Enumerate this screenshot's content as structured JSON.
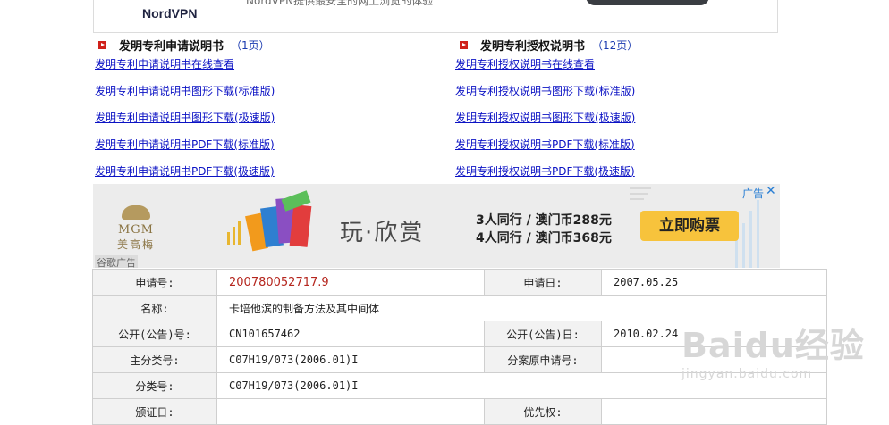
{
  "top_ad": {
    "brand": "NordVPN",
    "tagline": "NordVPN提供最安全的网上浏览的体验"
  },
  "application_section": {
    "title": "发明专利申请说明书",
    "count": "（1页）",
    "links": [
      "发明专利申请说明书在线查看",
      "发明专利申请说明书图形下载(标准版)",
      "发明专利申请说明书图形下载(极速版)",
      "发明专利申请说明书PDF下载(标准版)",
      "发明专利申请说明书PDF下载(极速版)"
    ]
  },
  "grant_section": {
    "title": "发明专利授权说明书",
    "count": "（12页）",
    "links": [
      "发明专利授权说明书在线查看",
      "发明专利授权说明书图形下载(标准版)",
      "发明专利授权说明书图形下载(极速版)",
      "发明专利授权说明书PDF下载(标准版)",
      "发明专利授权说明书PDF下载(极速版)"
    ]
  },
  "banner_ad": {
    "logo_text": "MGM",
    "logo_cn": "美高梅",
    "headline": "玩·欣赏",
    "offer1": "3人同行 / 澳门币288元",
    "offer2": "4人同行 / 澳门币368元",
    "cta": "立即购票",
    "ad_label": "广告",
    "ad_close": "✕",
    "ad_source": "谷歌广告"
  },
  "patent_info": {
    "rows": [
      {
        "k1": "申请号:",
        "v1": "200780052717.9",
        "k2": "申请日:",
        "v2": "2007.05.25"
      },
      {
        "k1": "名称:",
        "v1": "卡培他滨的制备方法及其中间体"
      },
      {
        "k1": "公开(公告)号:",
        "v1": "CN101657462",
        "k2": "公开(公告)日:",
        "v2": "2010.02.24"
      },
      {
        "k1": "主分类号:",
        "v1": "C07H19/073(2006.01)I",
        "k2": "分案原申请号:",
        "v2": ""
      },
      {
        "k1": "分类号:",
        "v1": "C07H19/073(2006.01)I"
      },
      {
        "k1": "颁证日:",
        "v1": "",
        "k2": "优先权:",
        "v2": ""
      }
    ]
  },
  "watermark": {
    "main": "Baidu经验",
    "sub": "jingyan.baidu.com"
  }
}
